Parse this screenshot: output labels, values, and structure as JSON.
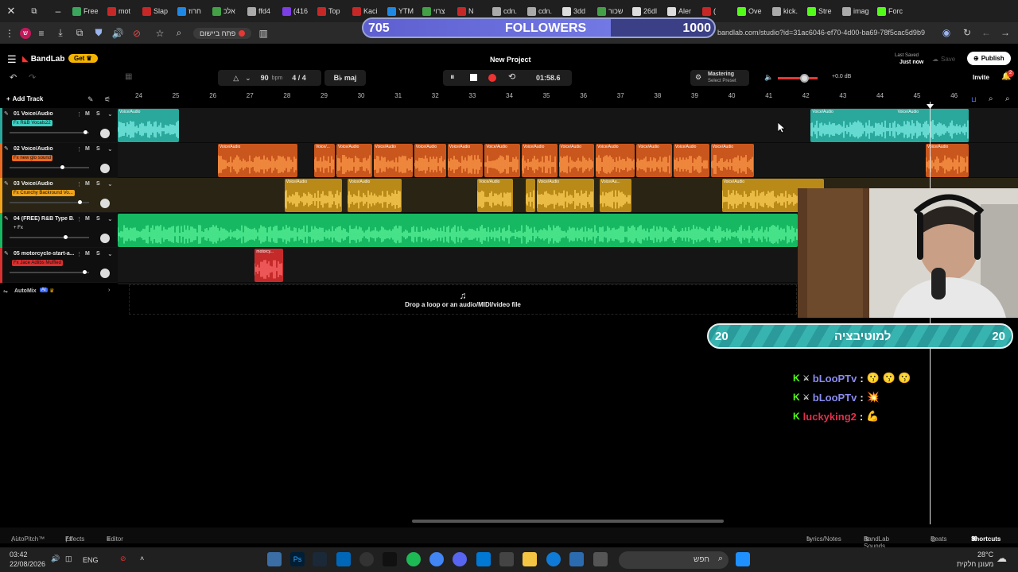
{
  "browser": {
    "tabs": [
      {
        "label": "Free",
        "color": "#3ba55d"
      },
      {
        "label": "mot",
        "color": "#c62828"
      },
      {
        "label": "Slap",
        "color": "#c62828"
      },
      {
        "label": "חרוז",
        "color": "#1e88e5"
      },
      {
        "label": "אלכ",
        "color": "#43a047"
      },
      {
        "label": "ffd4",
        "color": "#aaaaaa"
      },
      {
        "label": "(416",
        "color": "#7b3fe4"
      },
      {
        "label": "Top",
        "color": "#c62828"
      },
      {
        "label": "Kaci",
        "color": "#c62828"
      },
      {
        "label": "YTM",
        "color": "#1e88e5"
      },
      {
        "label": "צרוי",
        "color": "#43a047"
      },
      {
        "label": "N",
        "color": "#c62828"
      },
      {
        "label": "cdn.",
        "color": "#aaaaaa"
      },
      {
        "label": "cdn.",
        "color": "#aaaaaa"
      },
      {
        "label": "3dd",
        "color": "#dddddd"
      },
      {
        "label": "שכור",
        "color": "#43a047"
      },
      {
        "label": "26dl",
        "color": "#dddddd"
      },
      {
        "label": "Aler",
        "color": "#dddddd"
      },
      {
        "label": "(",
        "color": "#c62828"
      },
      {
        "label": "Ove",
        "color": "#53fc18"
      },
      {
        "label": "kick.",
        "color": "#aaaaaa"
      },
      {
        "label": "Stre",
        "color": "#53fc18"
      },
      {
        "label": "imag",
        "color": "#aaaaaa"
      },
      {
        "label": "Forc",
        "color": "#53fc18"
      }
    ],
    "bookmark_label": "פתח ביישום",
    "url": "bandlab.com/studio?id=31ac6046-ef70-4d00-ba69-78f5cac5d9b9"
  },
  "overlay": {
    "followers_current": "705",
    "followers_label": "FOLLOWERS",
    "followers_goal": "1000",
    "followers_progress": 0.705,
    "motivation_left": "20",
    "motivation_label": "למוטיבציה",
    "motivation_right": "20",
    "chat": [
      {
        "user": "bLooPTv",
        "user_color": "#8a8cf0",
        "message": "😗 😗 😗"
      },
      {
        "user": "bLooPTv",
        "user_color": "#8a8cf0",
        "message": "💥"
      },
      {
        "user": "luckyking2",
        "user_color": "#e0304b",
        "message": "💪"
      }
    ]
  },
  "app": {
    "brand": "BandLab",
    "get_label": "Get",
    "project_title": "New Project",
    "last_saved_label": "Last Saved",
    "last_saved_value": "Just now",
    "save_label": "Save",
    "publish_label": "Publish",
    "invite_label": "Invite",
    "notification_count": "2"
  },
  "transport": {
    "bpm": "90",
    "bpm_unit": "bpm",
    "time_signature": "4 / 4",
    "key": "B♭ maj",
    "time": "01:58.6",
    "mastering_label": "Mastering",
    "mastering_preset": "Select Preset",
    "master_volume": "+0.0 dB"
  },
  "timeline": {
    "add_track_label": "Add Track",
    "bars": [
      "24",
      "25",
      "26",
      "27",
      "28",
      "29",
      "30",
      "31",
      "32",
      "33",
      "34",
      "35",
      "36",
      "37",
      "38",
      "39",
      "40",
      "41",
      "42",
      "43",
      "44",
      "45",
      "46"
    ],
    "drop_hint": "Drop a loop or an audio/MIDI/video file",
    "automix_label": "AutoMix",
    "automix_badge": "AI"
  },
  "tracks": [
    {
      "number": "01",
      "name": "Voice/Audio",
      "fx": "Fx R&B Vocals22",
      "fx_color": "#3ed1c4",
      "color": "#2aa89c",
      "bar_color": "#2aa89c",
      "volume": 0.95,
      "clips": [
        {
          "label": "Voice/Audio",
          "start": 0,
          "end": 1.7
        },
        {
          "label": "Voice/Audio",
          "start": 18.7,
          "end": 23
        },
        {
          "label": "Voice/Audio",
          "start": 21,
          "end": 23
        }
      ]
    },
    {
      "number": "02",
      "name": "Voice/Audio",
      "fx": "Fx new glo sound",
      "fx_color": "#ea6a22",
      "color": "#c9561d",
      "bar_color": "#ea6a22",
      "volume": 0.66,
      "clips": [
        {
          "label": "Voice/Audio",
          "start": 2.7,
          "end": 4.9
        },
        {
          "label": "Voice/...",
          "start": 5.3,
          "end": 5.9
        },
        {
          "label": "Voice/Audio",
          "start": 5.9,
          "end": 6.9
        },
        {
          "label": "Voice/Audio",
          "start": 6.9,
          "end": 8
        },
        {
          "label": "Voice/Audio",
          "start": 8,
          "end": 8.9
        },
        {
          "label": "Voice/Audio",
          "start": 8.9,
          "end": 9.9
        },
        {
          "label": "Voice/Audio",
          "start": 9.9,
          "end": 10.9
        },
        {
          "label": "Voice/Audio",
          "start": 10.9,
          "end": 11.9
        },
        {
          "label": "Voice/Audio",
          "start": 11.9,
          "end": 12.9
        },
        {
          "label": "Voice/Audio",
          "start": 12.9,
          "end": 14
        },
        {
          "label": "Voice/Audio",
          "start": 14,
          "end": 15
        },
        {
          "label": "Voice/Audio",
          "start": 15,
          "end": 16
        },
        {
          "label": "Voice/Audio",
          "start": 16,
          "end": 17.2
        },
        {
          "label": "Voice/Audio",
          "start": 21.8,
          "end": 23
        }
      ]
    },
    {
      "number": "03",
      "name": "Voice/Audio",
      "fx": "Fx Crunchy Backround Vo...",
      "fx_color": "#f0a31b",
      "color": "#b98a17",
      "bar_color": "#f0a31b",
      "volume": 0.88,
      "clips": [
        {
          "label": "Voice/Audio",
          "start": 4.5,
          "end": 6.1
        },
        {
          "label": "Voice/Audio",
          "start": 6.2,
          "end": 7.7
        },
        {
          "label": "Voice/Audio",
          "start": 9.7,
          "end": 10.7
        },
        {
          "label": "",
          "start": 11.0,
          "end": 11.3
        },
        {
          "label": "Voice/Audio",
          "start": 11.3,
          "end": 12.9
        },
        {
          "label": "Voice/Au...",
          "start": 13.0,
          "end": 13.9
        },
        {
          "label": "Voice/Audio",
          "start": 16.3,
          "end": 19.1
        }
      ]
    },
    {
      "number": "04",
      "name": "(FREE) R&B Type B...",
      "fx": "+ Fx",
      "fx_color": "#0f0f0f",
      "color": "#17b862",
      "bar_color": "#17b862",
      "volume": 0.7,
      "clips": [
        {
          "label": "",
          "start": 0,
          "end": 18.4
        }
      ]
    },
    {
      "number": "05",
      "name": "motorcycle-start-a...",
      "fx": "Fx Jace Adlibs Muffled",
      "fx_color": "#d93030",
      "color": "#c42a2a",
      "bar_color": "#d93030",
      "volume": 0.94,
      "clips": [
        {
          "label": "motorcy...",
          "start": 3.7,
          "end": 4.5
        }
      ]
    }
  ],
  "bottom_bar": {
    "autopitch": "AutoPitch™",
    "effects": "Effects",
    "editor": "Editor",
    "lyrics": "Lyrics/Notes",
    "sounds": "BandLab Sounds",
    "beats": "Beats",
    "shortcuts": "Shortcuts"
  },
  "taskbar": {
    "time": "03:42",
    "date": "22/08/2026",
    "lang": "ENG",
    "search_placeholder": "חפש",
    "temperature": "28°C",
    "weather": "מעונן חלקית"
  }
}
